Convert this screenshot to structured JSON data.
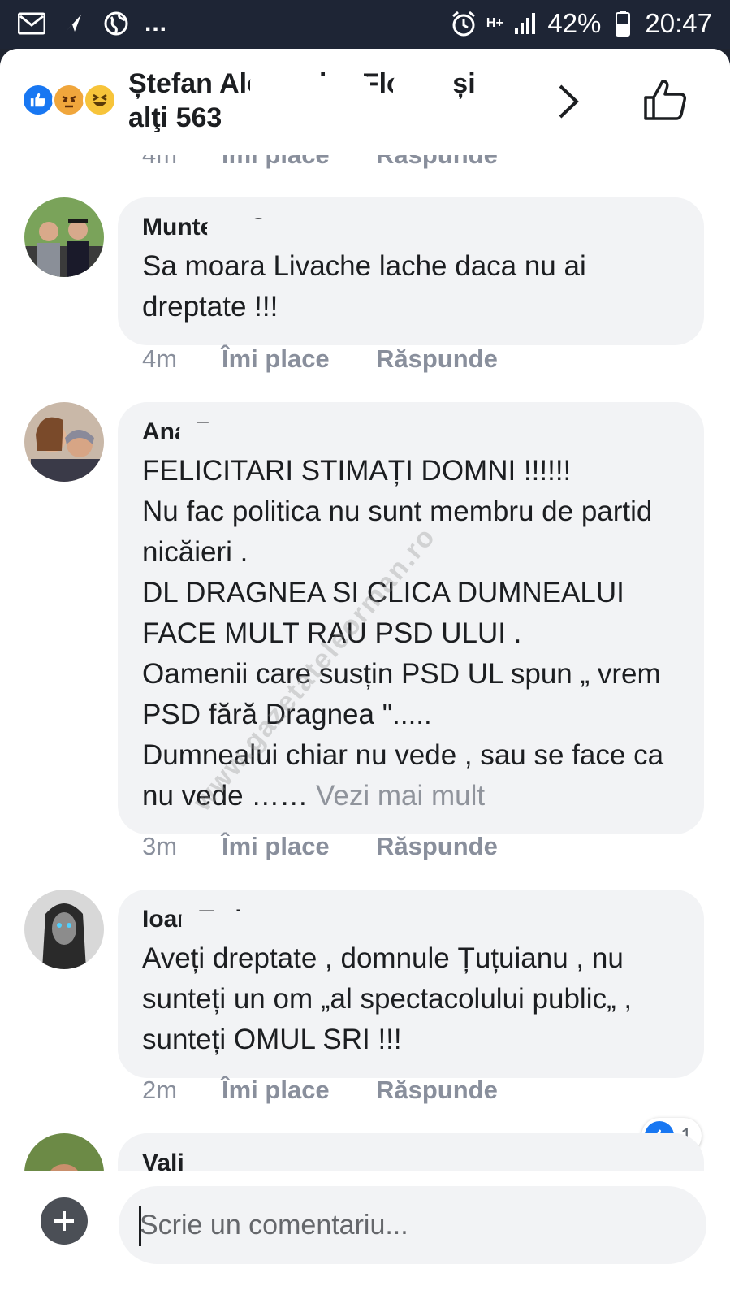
{
  "status_bar": {
    "icons": [
      "gmail-icon",
      "navigation-icon",
      "globe-icon"
    ],
    "overflow": "...",
    "network": "H+",
    "battery_percent": "42%",
    "time": "20:47"
  },
  "header": {
    "reactions": [
      "like",
      "angry",
      "haha"
    ],
    "title_line1": "Ștefan Alexandru Florea și",
    "title_line2": "alţi 563"
  },
  "actions": {
    "like": "Îmi place",
    "reply": "Răspunde"
  },
  "top_meta": {
    "time": "4m"
  },
  "comments": [
    {
      "author": "Muntean George",
      "text": "Sa moara Livache lache daca nu ai dreptate !!!",
      "time": "4m"
    },
    {
      "author": "Ana Zugravu",
      "text": "FELICITARI  STIMAȚI DOMNI  !!!!!!\nNu fac politica nu sunt membru de partid nicăieri .\nDL DRAGNEA   SI CLICA DUMNEALUI FACE MULT RAU PSD ULUI .\nOamenii care susțin PSD UL spun  „ vrem PSD  fără Dragnea \".....\nDumnealui chiar nu vede , sau se face ca nu vede ……",
      "see_more": " Vezi mai mult",
      "time": "3m"
    },
    {
      "author": "Ioan Tudor",
      "text": "Aveți dreptate , domnule Țuțuianu , nu sunteți un om „al spectacolului public„ , sunteți OMUL SRI !!!",
      "time": "2m",
      "reaction_count": "1"
    },
    {
      "author": "Vali Avram"
    }
  ],
  "watermark": "www.gazetateleorman.ro",
  "composer": {
    "placeholder": "Scrie un comentariu..."
  },
  "colors": {
    "status_bar": "#1e2535",
    "bubble": "#f2f3f5",
    "meta_text": "#898f9c",
    "like_blue": "#1877f2"
  }
}
